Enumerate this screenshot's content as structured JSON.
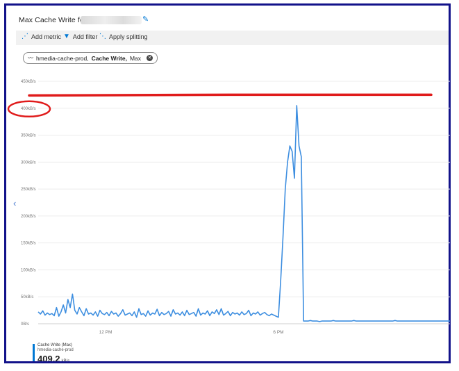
{
  "header": {
    "title": "Max Cache Write for"
  },
  "toolbar": {
    "add_metric": "Add metric",
    "add_filter": "Add filter",
    "apply_splitting": "Apply splitting"
  },
  "metric_pill": {
    "resource": "hmedia-cache-prod,",
    "metric": "Cache Write,",
    "aggregation": "Max"
  },
  "legend": {
    "name": "Cache Write (Max)",
    "resource": "hmedia-cache-prod",
    "value": "409.2",
    "unit": "kB/s"
  },
  "annotation": {
    "threshold_kbps": 425,
    "color": "#e01b1b",
    "circled_label": "400kB/s"
  },
  "chart_data": {
    "type": "line",
    "yticks": [
      "450kB/s",
      "400kB/s",
      "350kB/s",
      "300kB/s",
      "250kB/s",
      "200kB/s",
      "150kB/s",
      "100kB/s",
      "50kB/s",
      "0B/s"
    ],
    "ytick_values": [
      450,
      400,
      350,
      300,
      250,
      200,
      150,
      100,
      50,
      0
    ],
    "ylim": [
      0,
      450
    ],
    "xticks": [
      "12 PM",
      "6 PM"
    ],
    "grid": true,
    "series": [
      {
        "name": "Cache Write (Max)",
        "color": "#3d8ee0",
        "values": [
          22,
          18,
          24,
          16,
          20,
          17,
          19,
          15,
          30,
          14,
          22,
          35,
          20,
          45,
          30,
          55,
          25,
          18,
          30,
          22,
          15,
          28,
          18,
          20,
          16,
          22,
          14,
          25,
          19,
          17,
          21,
          15,
          23,
          18,
          20,
          14,
          19,
          26,
          16,
          18,
          20,
          15,
          22,
          12,
          28,
          17,
          19,
          14,
          24,
          16,
          20,
          18,
          27,
          15,
          21,
          17,
          19,
          23,
          14,
          26,
          18,
          20,
          16,
          22,
          15,
          25,
          17,
          19,
          21,
          14,
          28,
          16,
          20,
          18,
          24,
          15,
          22,
          19,
          26,
          17,
          28,
          16,
          19,
          23,
          15,
          21,
          18,
          20,
          16,
          22,
          17,
          19,
          25,
          15,
          20,
          18,
          22,
          16,
          19,
          21,
          17,
          15,
          18,
          16,
          14,
          12,
          80,
          160,
          250,
          300,
          330,
          320,
          270,
          405,
          330,
          310,
          5,
          5,
          5,
          6,
          5,
          5,
          5,
          4,
          5,
          5,
          5,
          5,
          5,
          6,
          5,
          5,
          5,
          5,
          5,
          5,
          5,
          5,
          6,
          5,
          5,
          5,
          5,
          5,
          5,
          5,
          5,
          5,
          5,
          5,
          5,
          5,
          5,
          5,
          5,
          5,
          6,
          5,
          5,
          5,
          5,
          5,
          5,
          5,
          5,
          5,
          5,
          5,
          5,
          5,
          5,
          5,
          5,
          5,
          5,
          5,
          5,
          5,
          5,
          5,
          5
        ]
      }
    ]
  }
}
